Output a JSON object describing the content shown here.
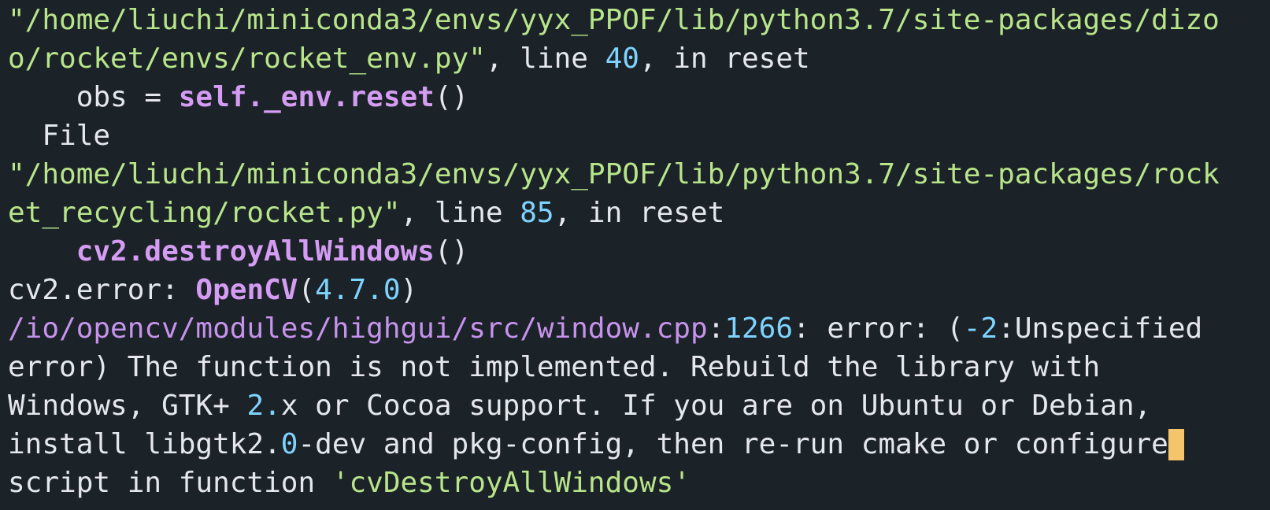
{
  "terminal": {
    "lines": [
      [
        {
          "t": "\"/home/liuchi/miniconda3/envs/yyx_PPOF/lib/python3.7/site-packages/dizo",
          "c": "str"
        }
      ],
      [
        {
          "t": "o/rocket/envs/rocket_env.py\"",
          "c": "str"
        },
        {
          "t": ", line ",
          "c": "plain"
        },
        {
          "t": "40",
          "c": "num"
        },
        {
          "t": ", in reset",
          "c": "plain"
        }
      ],
      [
        {
          "t": "    obs = ",
          "c": "plain"
        },
        {
          "t": "self._env.reset",
          "c": "fn"
        },
        {
          "t": "()",
          "c": "plain"
        }
      ],
      [
        {
          "t": "  File",
          "c": "plain"
        }
      ],
      [
        {
          "t": "\"/home/liuchi/miniconda3/envs/yyx_PPOF/lib/python3.7/site-packages/rock",
          "c": "str"
        }
      ],
      [
        {
          "t": "et_recycling/rocket.py\"",
          "c": "str"
        },
        {
          "t": ", line ",
          "c": "plain"
        },
        {
          "t": "85",
          "c": "num"
        },
        {
          "t": ", in reset",
          "c": "plain"
        }
      ],
      [
        {
          "t": "    ",
          "c": "plain"
        },
        {
          "t": "cv2.destroyAllWindows",
          "c": "fn"
        },
        {
          "t": "()",
          "c": "plain"
        }
      ],
      [
        {
          "t": "cv2.error: ",
          "c": "plain"
        },
        {
          "t": "OpenCV",
          "c": "fn"
        },
        {
          "t": "(",
          "c": "plain"
        },
        {
          "t": "4.7.0",
          "c": "num"
        },
        {
          "t": ")",
          "c": "plain"
        }
      ],
      [
        {
          "t": "/io/opencv/modules/highgui/src/window.cpp",
          "c": "path"
        },
        {
          "t": ":",
          "c": "plain"
        },
        {
          "t": "1266",
          "c": "num"
        },
        {
          "t": ": error: (",
          "c": "plain"
        },
        {
          "t": "-2",
          "c": "num"
        },
        {
          "t": ":Unspecified",
          "c": "plain"
        }
      ],
      [
        {
          "t": "error) The function is not implemented. Rebuild the library with",
          "c": "plain"
        }
      ],
      [
        {
          "t": "Windows, GTK+ ",
          "c": "plain"
        },
        {
          "t": "2.",
          "c": "num"
        },
        {
          "t": "x or Cocoa support. If you are on Ubuntu or Debian,",
          "c": "plain"
        }
      ],
      [
        {
          "t": "install libgtk2.",
          "c": "plain"
        },
        {
          "t": "0",
          "c": "num"
        },
        {
          "t": "-dev and pkg-config, then re-run cmake or configure",
          "c": "plain"
        }
      ],
      [
        {
          "t": "script in function ",
          "c": "plain"
        },
        {
          "t": "'cvDestroyAllWindows'",
          "c": "str"
        }
      ]
    ],
    "cursor_line": 11,
    "cursor_color": "#f5c56b"
  }
}
